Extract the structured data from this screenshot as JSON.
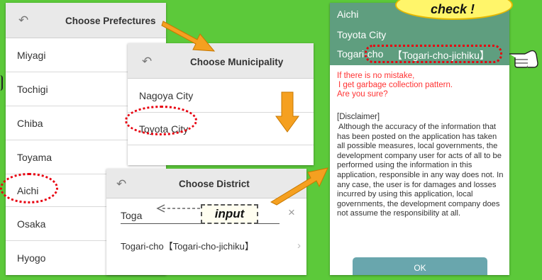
{
  "prefectures": {
    "title": "Choose Prefectures",
    "items": [
      "Miyagi",
      "Tochigi",
      "Chiba",
      "Toyama",
      "Aichi",
      "Osaka",
      "Hyogo"
    ]
  },
  "municipality": {
    "title": "Choose Municipality",
    "items": [
      "Nagoya City",
      "Toyota City"
    ]
  },
  "district": {
    "title": "Choose District",
    "search_value": "Toga",
    "input_callout": "input",
    "clear_icon": "×",
    "items": [
      "Togari-cho【Togari-cho-jichiku】"
    ]
  },
  "confirm": {
    "lines": [
      "Aichi",
      "Toyota City"
    ],
    "district_prefix": "Togari-cho",
    "district_highlight": "【Togari-cho-jichiku】",
    "warning": [
      "If there is no mistake,",
      "I get garbage collection pattern.",
      "Are you sure?"
    ],
    "disclaimer_title": "[Disclaimer]",
    "disclaimer_text": "Although the accuracy of the information that has been posted on the application has taken all possible measures, local governments, the development company user for acts of all to be performed using the information in this application, responsible in any way does not. In any case, the user is for damages and losses incurred by using this application, local governments, the development company does not assume the responsibility at all.",
    "ok_label": "OK"
  },
  "callout": {
    "check": "check !"
  },
  "icons": {
    "back": "back-arrow-icon",
    "clear": "close-icon",
    "pointer": "pointing-hand-icon"
  },
  "colors": {
    "background": "#5cc93a",
    "confirm_header": "#5f9e7f",
    "highlight": "#e8000f",
    "warning_text": "#ff3333",
    "arrow_orange": "#f5a020",
    "ok_button": "#69a6ad"
  }
}
